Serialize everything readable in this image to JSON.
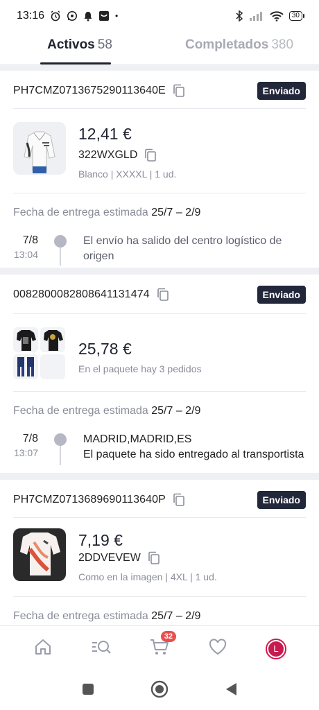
{
  "status_bar": {
    "time": "13:16",
    "battery": "30",
    "dot": "•"
  },
  "tabs": [
    {
      "label": "Activos",
      "count": "58"
    },
    {
      "label": "Completados",
      "count": "380"
    }
  ],
  "orders": [
    {
      "tracking": "PH7CMZ0713675290113640E",
      "status": "Enviado",
      "price": "12,41 €",
      "sku": "322WXGLD",
      "meta": "Blanco | XXXXL | 1 ud.",
      "eta_label": "Fecha de entrega estimada",
      "eta_dates": "25/7 – 2/9",
      "event": {
        "date": "7/8",
        "time": "13:04",
        "text_line1": "El envío ha salido del centro logístico de",
        "text_line2": "origen"
      }
    },
    {
      "tracking": "0082800082808641131474",
      "status": "Enviado",
      "price": "25,78 €",
      "package_note": "En el paquete hay 3 pedidos",
      "eta_label": "Fecha de entrega estimada",
      "eta_dates": "25/7 – 2/9",
      "event": {
        "date": "7/8",
        "time": "13:07",
        "location": "MADRID,MADRID,ES",
        "text": "El paquete ha sido entregado al transportista"
      }
    },
    {
      "tracking": "PH7CMZ0713689690113640P",
      "status": "Enviado",
      "price": "7,19 €",
      "sku": "2DDVEVEW",
      "meta": "Como en la imagen | 4XL | 1 ud.",
      "eta_label": "Fecha de entrega estimada",
      "eta_dates": "25/7 – 2/9"
    }
  ],
  "bottom_nav": {
    "cart_count": "32",
    "avatar_letter": "L",
    "items": [
      "home-icon",
      "search-list-icon",
      "cart-icon",
      "heart-icon",
      "avatar"
    ]
  },
  "colors": {
    "accent": "#23273a",
    "badge_red": "#e8504d",
    "avatar": "#c81950"
  }
}
